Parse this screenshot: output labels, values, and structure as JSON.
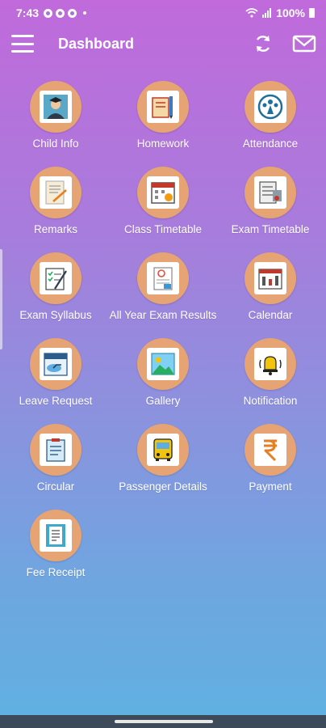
{
  "status": {
    "time": "7:43",
    "battery": "100%"
  },
  "header": {
    "title": "Dashboard"
  },
  "tiles": [
    {
      "label": "Child Info",
      "icon": "child-info-icon"
    },
    {
      "label": "Homework",
      "icon": "homework-icon"
    },
    {
      "label": "Attendance",
      "icon": "attendance-icon"
    },
    {
      "label": "Remarks",
      "icon": "remarks-icon"
    },
    {
      "label": "Class Timetable",
      "icon": "class-timetable-icon"
    },
    {
      "label": "Exam Timetable",
      "icon": "exam-timetable-icon"
    },
    {
      "label": "Exam Syllabus",
      "icon": "exam-syllabus-icon"
    },
    {
      "label": "All Year Exam Results",
      "icon": "exam-results-icon"
    },
    {
      "label": "Calendar",
      "icon": "calendar-icon"
    },
    {
      "label": "Leave Request",
      "icon": "leave-request-icon"
    },
    {
      "label": "Gallery",
      "icon": "gallery-icon"
    },
    {
      "label": "Notification",
      "icon": "notification-bell-icon"
    },
    {
      "label": "Circular",
      "icon": "circular-icon"
    },
    {
      "label": "Passenger Details",
      "icon": "bus-icon"
    },
    {
      "label": "Payment",
      "icon": "rupee-icon"
    },
    {
      "label": "Fee Receipt",
      "icon": "fee-receipt-icon"
    }
  ],
  "colors": {
    "icon_circle": "#e6a373",
    "bg_top": "#c06adb",
    "bg_bottom": "#5fb1e2"
  }
}
